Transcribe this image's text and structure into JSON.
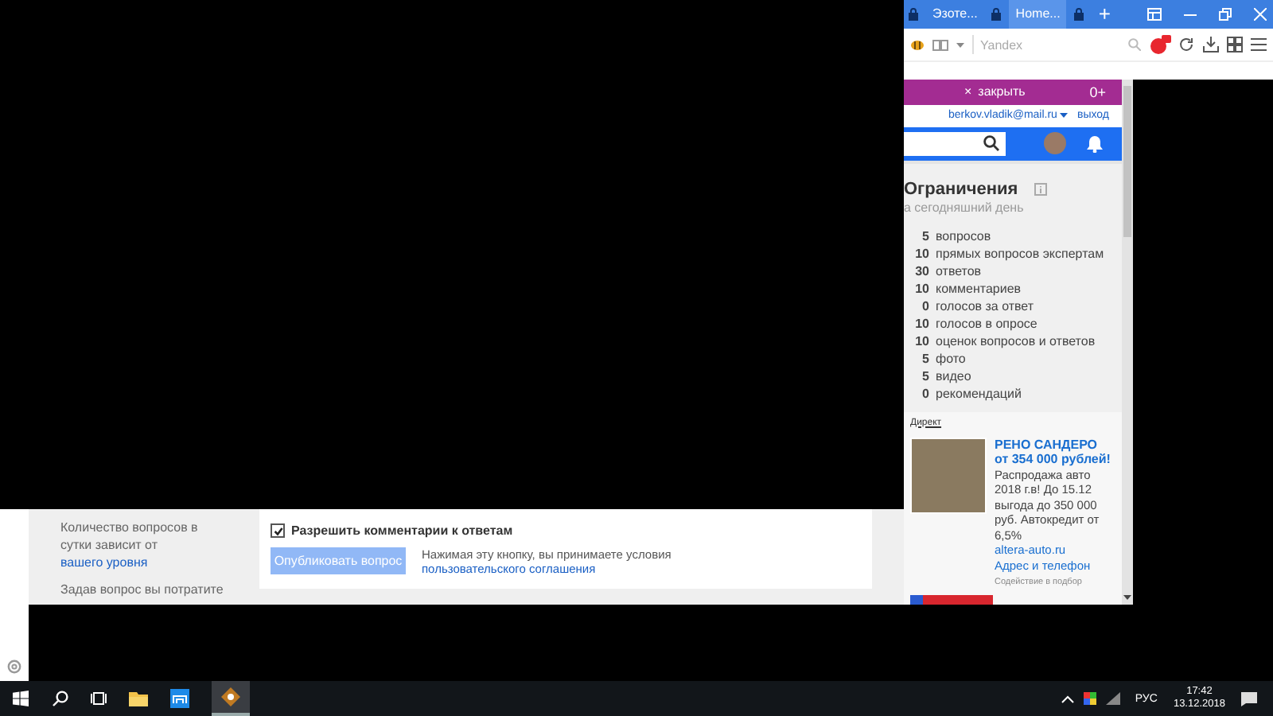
{
  "browser": {
    "tabs": [
      {
        "label": "Эзоте...",
        "selected": false
      },
      {
        "label": "Home...",
        "selected": true
      }
    ],
    "new_tab": "+",
    "address": {
      "placeholder": "Yandex"
    },
    "promo_bar": {
      "close_mark": "×",
      "close": "закрыть",
      "age": "0+"
    },
    "account": {
      "email": "berkov.vladik@mail.ru",
      "logout": "выход"
    },
    "limits": {
      "title": "Ограничения",
      "subtitle": "а сегодняшний день",
      "items": [
        {
          "count": "5",
          "label": "вопросов"
        },
        {
          "count": "10",
          "label": "прямых вопросов экспертам"
        },
        {
          "count": "30",
          "label": "ответов"
        },
        {
          "count": "10",
          "label": "комментариев"
        },
        {
          "count": "0",
          "label": "голосов за ответ"
        },
        {
          "count": "10",
          "label": "голосов в опросе"
        },
        {
          "count": "10",
          "label": "оценок вопросов и ответов"
        },
        {
          "count": "5",
          "label": "фото"
        },
        {
          "count": "5",
          "label": "видео"
        },
        {
          "count": "0",
          "label": "рекомендаций"
        }
      ]
    },
    "ad": {
      "label": "Директ",
      "title": "РЕНО САНДЕРО от 354 000 рублей!",
      "text": "Распродажа авто 2018 г.в! До 15.12 выгода до 350 000 руб. Автокредит от 6,5%",
      "domain": "altera-auto.ru",
      "contacts": "Адрес и телефон",
      "note": "Содействие в подбор"
    }
  },
  "question_window": {
    "sidebar": [
      {
        "text": "Количество вопросов в сутки зависит от ",
        "link": "вашего уровня"
      },
      {
        "text": "Задав вопрос вы потратите"
      }
    ],
    "comments_checkbox": {
      "label": "Разрешить комментарии к ответам",
      "checked": true
    },
    "publish_button": {
      "label": "Опубликовать вопрос",
      "disabled": true
    },
    "terms": {
      "text": "Нажимая эту кнопку, вы принимаете условия ",
      "link": "пользовательского соглашения"
    }
  },
  "taskbar": {
    "language": "РУС",
    "time": "17:42",
    "date": "13.12.2018"
  }
}
